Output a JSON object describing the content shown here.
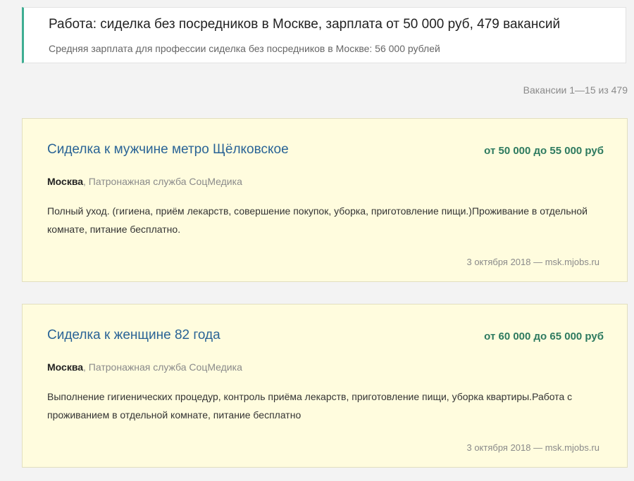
{
  "header": {
    "title": "Работа: сиделка без посредников в Москве, зарплата от 50 000 руб, 479 вакансий",
    "subtitle": "Средняя зарплата для профессии сиделка без посредников в Москве: 56 000 рублей"
  },
  "counter": "Вакансии 1—15 из 479",
  "vacancies": [
    {
      "title": "Сиделка к мужчине метро Щёлковское",
      "salary": "от 50 000 до 55 000 руб",
      "city": "Москва",
      "company": ", Патронажная служба СоцМедика",
      "description": "Полный уход. (гигиена, приём лекарств, совершение покупок, уборка, приготовление пищи.)Проживание в отдельной комнате, питание бесплатно.",
      "footer": "3 октября 2018 — msk.mjobs.ru"
    },
    {
      "title": "Сиделка к женщине 82 года",
      "salary": "от 60 000 до 65 000 руб",
      "city": "Москва",
      "company": ", Патронажная служба СоцМедика",
      "description": "Выполнение гигиенических процедур, контроль приёма лекарств, приготовление пищи, уборка квартиры.Работа с проживанием в отдельной комнате, питание бесплатно",
      "footer": "3 октября 2018 — msk.mjobs.ru"
    }
  ]
}
